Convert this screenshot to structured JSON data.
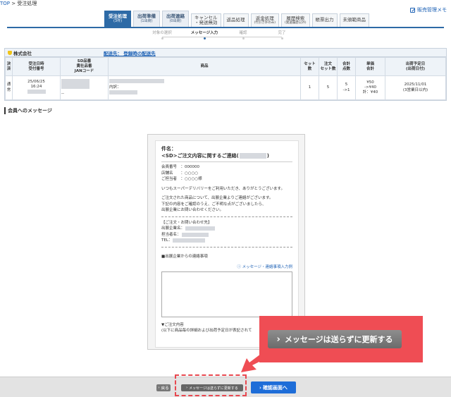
{
  "breadcrumb": {
    "top": "TOP",
    "sep": " > ",
    "current": "受注処理"
  },
  "header": {
    "sales_memo": "販売管理メモ"
  },
  "tabs": [
    {
      "label": "受注処理",
      "sub": "(3件)"
    },
    {
      "label": "出荷準備",
      "sub": "(1出荷)"
    },
    {
      "label": "出荷連絡",
      "sub": "(0出荷)"
    },
    {
      "label": "キャンセル",
      "sub": "・発送無効"
    },
    {
      "label": "返品処理",
      "sub": ""
    },
    {
      "label": "返金処理",
      "sub": "(代引き外のみ)"
    },
    {
      "label": "履歴検索",
      "sub": "(発送履歴以外)"
    },
    {
      "label": "帳票出力",
      "sub": ""
    },
    {
      "label": "未頒範商品",
      "sub": ""
    }
  ],
  "steps": [
    "対象の選択",
    "メッセージ入力",
    "確認",
    "完了"
  ],
  "order": {
    "company": "株式会社",
    "ship_to": "配送先： 登録時の配送先",
    "headers": [
      "決済",
      "受注日時\n受付番号",
      "SD品番\n貴社品番\nJANコード",
      "商品",
      "セット\n数",
      "注文\nセット数",
      "合計\n点数",
      "単価",
      "合計",
      "出荷予定日\n(出荷日付)"
    ],
    "row": {
      "payment": "通常",
      "date": "25/06/25",
      "time": "16:24",
      "code_dash": "--",
      "product_detail": "内訳：",
      "sets": "1",
      "order_sets": "5",
      "total_qty": "5",
      "total_qty_arrow": "->1",
      "unit_price": "¥50",
      "unit_price_arrow": "->¥40",
      "total_price": "計：¥40",
      "ship_date": "2025/11/01",
      "ship_note": "(3営業日以内)"
    }
  },
  "section_title": "会員へのメッセージ",
  "message": {
    "subject_label": "件名：",
    "subject": "<SD>ご注文内容に関するご連絡(",
    "subject_end": ")",
    "member_no": "会員番号　：000000",
    "store": "店舗名　　：○○○○",
    "customer": "ご担当者　：○○○○様",
    "greeting": "いつもスーパーデリバリーをご利用いただき、ありがとうございます。",
    "body1": "ご注文された商品について、出展企業よりご連絡がございます。",
    "body2": "下記の内容をご確認のうえ、ご不明な点がございましたら、",
    "body3": "出展企業にお問い合わせください。",
    "contact_title": "【ご注文・お問い合わせ先】",
    "exhibitor": "出展企業名：",
    "person": "担当者名：",
    "tel": "TEL：",
    "note_title": "■出展企業からの連絡事項",
    "help_link": "メッセージ・連絡事項入力例",
    "order_content_title": "▼ご注文内容",
    "order_content_note": "(以下に商品毎の詳細および出荷予定日が表記されて"
  },
  "footer": {
    "back": "戻る",
    "update": "メッセージは送らずに更新する",
    "confirm": "確認画面へ"
  },
  "callout": {
    "label": "メッセージは送らずに更新する"
  },
  "colors": {
    "accent": "#2d6aa6",
    "highlight": "#ef4d54",
    "confirm": "#1e6dd8"
  }
}
